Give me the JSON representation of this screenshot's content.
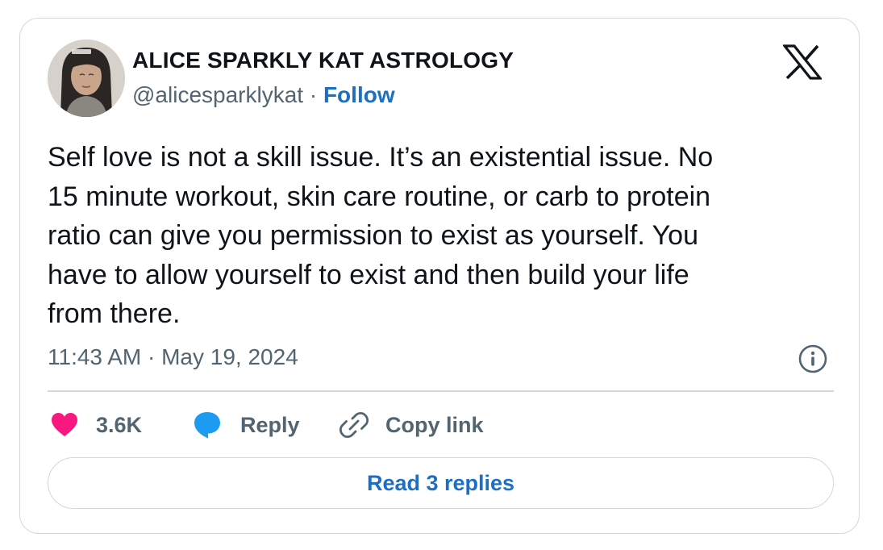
{
  "author": {
    "name": "ALICE SPARKLY KAT ASTROLOGY",
    "handle": "@alicesparklykat",
    "separator": " · ",
    "follow_label": "Follow",
    "avatar": "profile-photo"
  },
  "brand": {
    "logo": "x-logo-icon"
  },
  "tweet": {
    "lines": [
      "Self love is not a skill issue. It’s an existential issue. No",
      "15 minute workout, skin care routine, or carb to protein",
      "ratio can give you permission to exist as yourself. You",
      "have to allow yourself to exist and then build your life",
      "from there."
    ],
    "timestamp": "11:43 AM · May 19, 2024"
  },
  "actions": {
    "like": {
      "icon": "heart-icon",
      "label": "3.6K"
    },
    "reply": {
      "icon": "speech-bubble-icon",
      "label": "Reply"
    },
    "copy": {
      "icon": "link-icon",
      "label": "Copy link"
    }
  },
  "read_replies_label": "Read 3 replies",
  "colors": {
    "text": "#0f1419",
    "secondary": "#536471",
    "link": "#1d6fc4",
    "like": "#f91880",
    "reply": "#1d9bf0",
    "border": "#cfd9de"
  }
}
